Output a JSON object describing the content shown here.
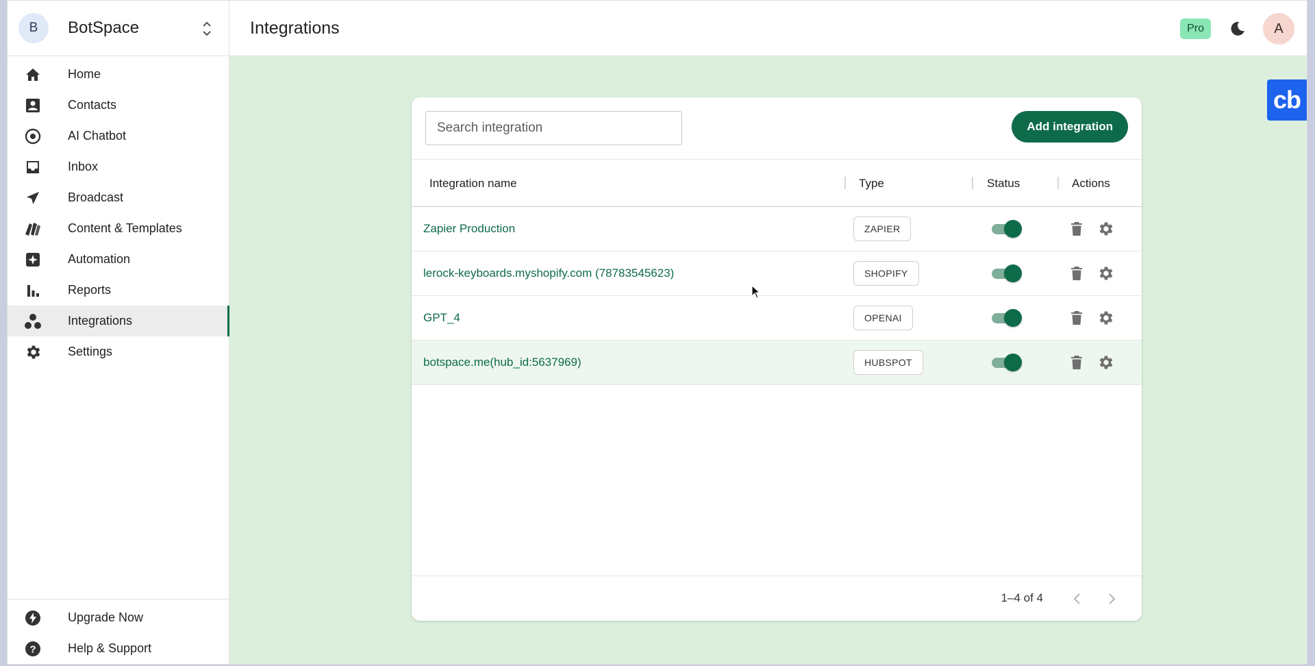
{
  "brand": {
    "initial": "B",
    "name": "BotSpace",
    "switch_icon": "unfold-icon"
  },
  "sidebar": {
    "items": [
      {
        "label": "Home",
        "icon": "home-icon"
      },
      {
        "label": "Contacts",
        "icon": "contacts-icon"
      },
      {
        "label": "AI Chatbot",
        "icon": "ai-chatbot-icon"
      },
      {
        "label": "Inbox",
        "icon": "inbox-icon"
      },
      {
        "label": "Broadcast",
        "icon": "send-icon"
      },
      {
        "label": "Content & Templates",
        "icon": "templates-icon"
      },
      {
        "label": "Automation",
        "icon": "automation-icon"
      },
      {
        "label": "Reports",
        "icon": "bar-chart-icon"
      },
      {
        "label": "Integrations",
        "icon": "integrations-icon",
        "active": true
      },
      {
        "label": "Settings",
        "icon": "gear-icon"
      }
    ],
    "bottom_items": [
      {
        "label": "Upgrade Now",
        "icon": "bolt-icon"
      },
      {
        "label": "Help & Support",
        "icon": "help-icon"
      }
    ]
  },
  "header": {
    "title": "Integrations",
    "plan_badge": "Pro",
    "user_initial": "A"
  },
  "widget": {
    "label": "cb"
  },
  "search": {
    "placeholder": "Search integration",
    "value": ""
  },
  "toolbar": {
    "add_label": "Add integration"
  },
  "table": {
    "columns": [
      "Integration name",
      "Type",
      "Status",
      "Actions"
    ],
    "rows": [
      {
        "name": "Zapier Production",
        "type": "ZAPIER",
        "status_on": true
      },
      {
        "name": "lerock-keyboards.myshopify.com (78783545623)",
        "type": "SHOPIFY",
        "status_on": true
      },
      {
        "name": "GPT_4",
        "type": "OPENAI",
        "status_on": true
      },
      {
        "name": "botspace.me(hub_id:5637969)",
        "type": "HUBSPOT",
        "status_on": true
      }
    ]
  },
  "pagination": {
    "text": "1–4 of 4"
  },
  "colors": {
    "accent": "#0e6b4a",
    "main_bg": "#dcefdd",
    "pro_badge": "#8ae6b4",
    "widget": "#1d63ee"
  }
}
